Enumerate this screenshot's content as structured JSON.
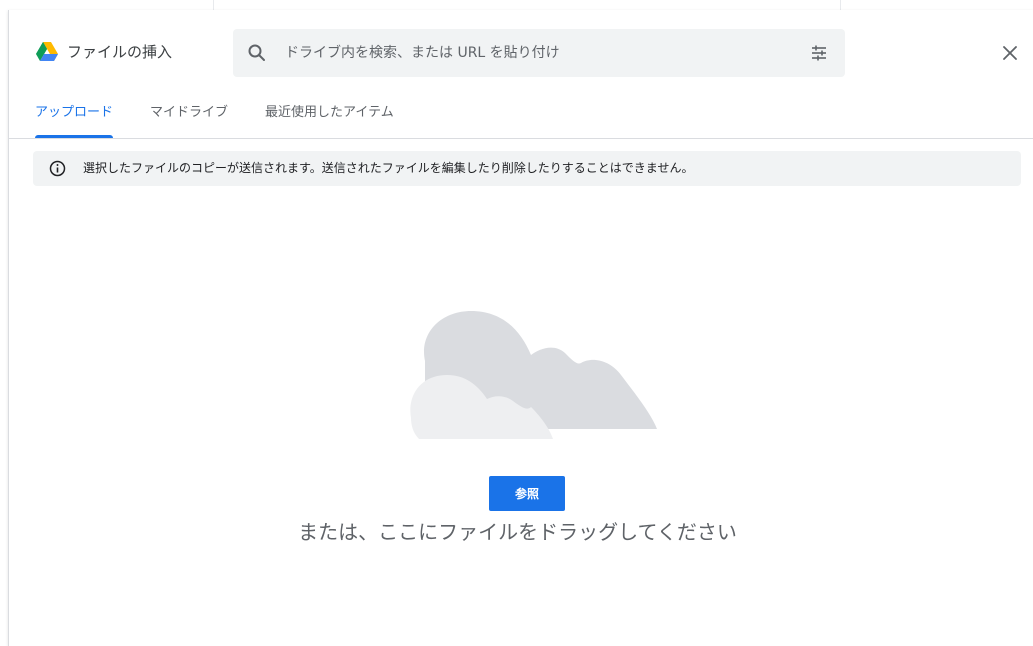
{
  "dialog": {
    "title": "ファイルの挿入",
    "logo": "google-drive-logo",
    "close_icon": "close-icon"
  },
  "search": {
    "placeholder": "ドライブ内を検索、または URL を貼り付け",
    "value": "",
    "icon": "search-icon",
    "filter_icon": "filter-options-icon"
  },
  "tabs": [
    {
      "label": "アップロード",
      "active": true
    },
    {
      "label": "マイドライブ",
      "active": false
    },
    {
      "label": "最近使用したアイテム",
      "active": false
    }
  ],
  "info_banner": {
    "icon": "info-icon",
    "text": "選択したファイルのコピーが送信されます。送信されたファイルを編集したり削除したりすることはできません。"
  },
  "upload": {
    "illustration": "cloud-illustration",
    "browse_label": "参照",
    "drag_text": "または、ここにファイルをドラッグしてください"
  },
  "colors": {
    "accent": "#1a73e8",
    "banner_bg": "#f1f3f4",
    "cloud_dark": "#dadce0",
    "cloud_light": "#e8eaed"
  }
}
